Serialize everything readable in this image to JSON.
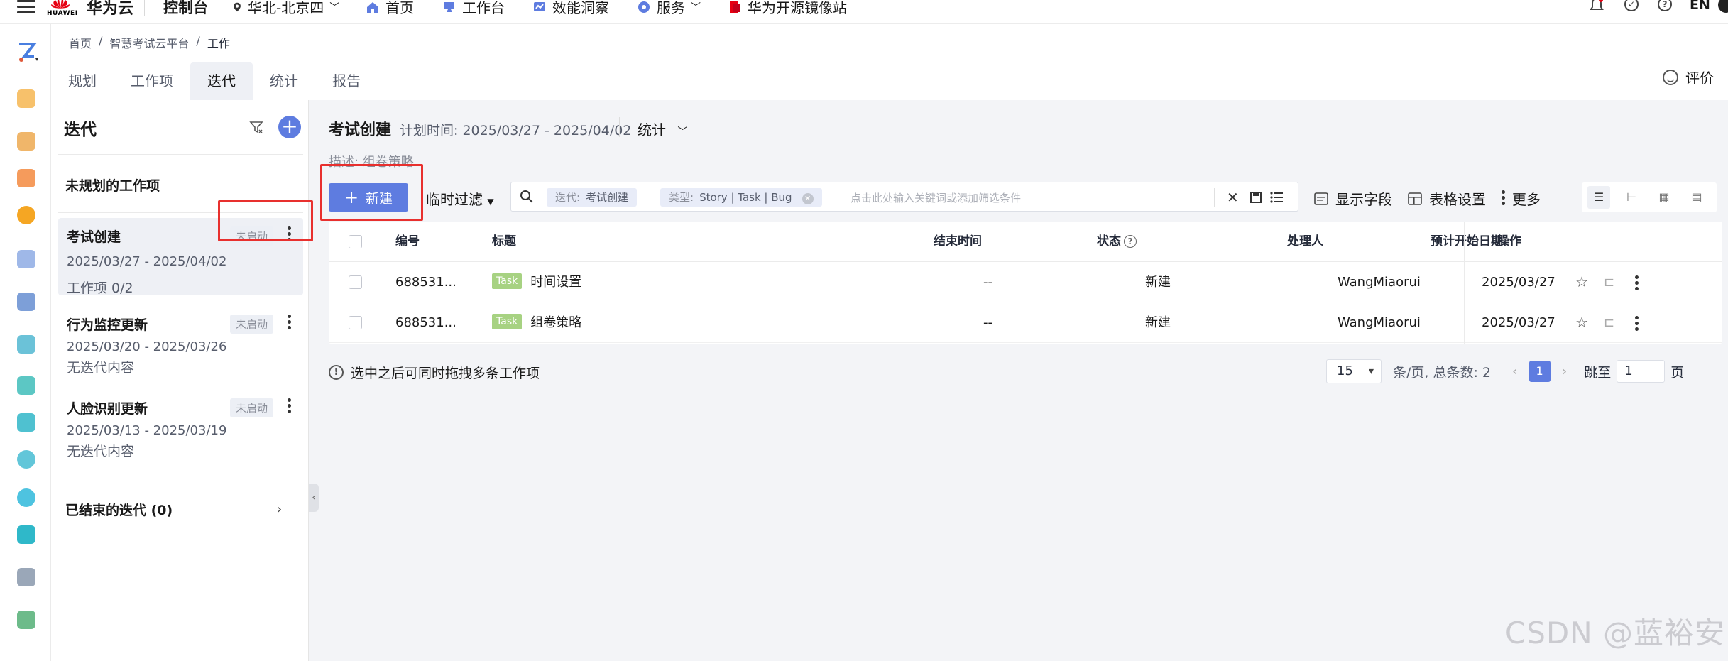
{
  "topbar": {
    "brand_mark": "HUAWEI",
    "brand": "华为云",
    "console": "控制台",
    "region": "华北-北京四",
    "nav": [
      {
        "label": "首页",
        "icon": "home-icon"
      },
      {
        "label": "工作台",
        "icon": "workbench-icon"
      },
      {
        "label": "效能洞察",
        "icon": "insight-icon"
      },
      {
        "label": "服务",
        "icon": "service-icon"
      },
      {
        "label": "华为开源镜像站",
        "icon": "mirror-icon"
      }
    ],
    "lang": "EN"
  },
  "breadcrumb": {
    "items": [
      "首页",
      "智慧考试云平台",
      "工作"
    ],
    "separator": "/"
  },
  "tabs": [
    "规划",
    "工作项",
    "迭代",
    "统计",
    "报告"
  ],
  "active_tab": "迭代",
  "rate_label": "评价",
  "sidebar": {
    "title": "迭代",
    "unplanned": "未规划的工作项",
    "iterations": [
      {
        "name": "考试创建",
        "badge": "未启动",
        "date": "2025/03/27 - 2025/04/02",
        "sub": "工作项 0/2",
        "selected": true
      },
      {
        "name": "行为监控更新",
        "badge": "未启动",
        "date": "2025/03/20 - 2025/03/26",
        "sub": "无迭代内容",
        "selected": false
      },
      {
        "name": "人脸识别更新",
        "badge": "未启动",
        "date": "2025/03/13 - 2025/03/19",
        "sub": "无迭代内容",
        "selected": false
      }
    ],
    "ended": "已结束的迭代 (0)"
  },
  "main": {
    "title": "考试创建",
    "plan_time": "计划时间: 2025/03/27 - 2025/04/02",
    "stats": "统计",
    "desc": "描述: 组卷策略",
    "new_button": "新建",
    "temp_filter": "临时过滤",
    "chips": [
      {
        "key": "迭代:",
        "value": "考试创建"
      },
      {
        "key": "类型:",
        "value": "Story  |  Task  |  Bug"
      }
    ],
    "search_placeholder": "点击此处输入关键词或添加筛选条件",
    "show_fields": "显示字段",
    "table_settings": "表格设置",
    "more": "更多"
  },
  "table": {
    "headers": [
      "编号",
      "标题",
      "结束时间",
      "状态",
      "处理人",
      "预计开始日期",
      "操作"
    ],
    "rows": [
      {
        "id": "688531...",
        "type": "Task",
        "title": "时间设置",
        "end": "--",
        "status": "新建",
        "assignee": "WangMiaorui",
        "start": "2025/03/27"
      },
      {
        "id": "688531...",
        "type": "Task",
        "title": "组卷策略",
        "end": "--",
        "status": "新建",
        "assignee": "WangMiaorui",
        "start": "2025/03/27"
      }
    ]
  },
  "footer": {
    "hint": "选中之后可同时拖拽多条工作项",
    "page_size": "15",
    "per_page": "条/页, 总条数: 2",
    "current_page": "1",
    "jump_label": "跳至",
    "jump_value": "1",
    "page_unit": "页"
  },
  "watermark": "CSDN @蓝裕安",
  "colors": {
    "primary": "#5e7ce0",
    "highlight": "#e8302e",
    "task_tag": "#a7d282",
    "bg": "#f3f4f7"
  }
}
